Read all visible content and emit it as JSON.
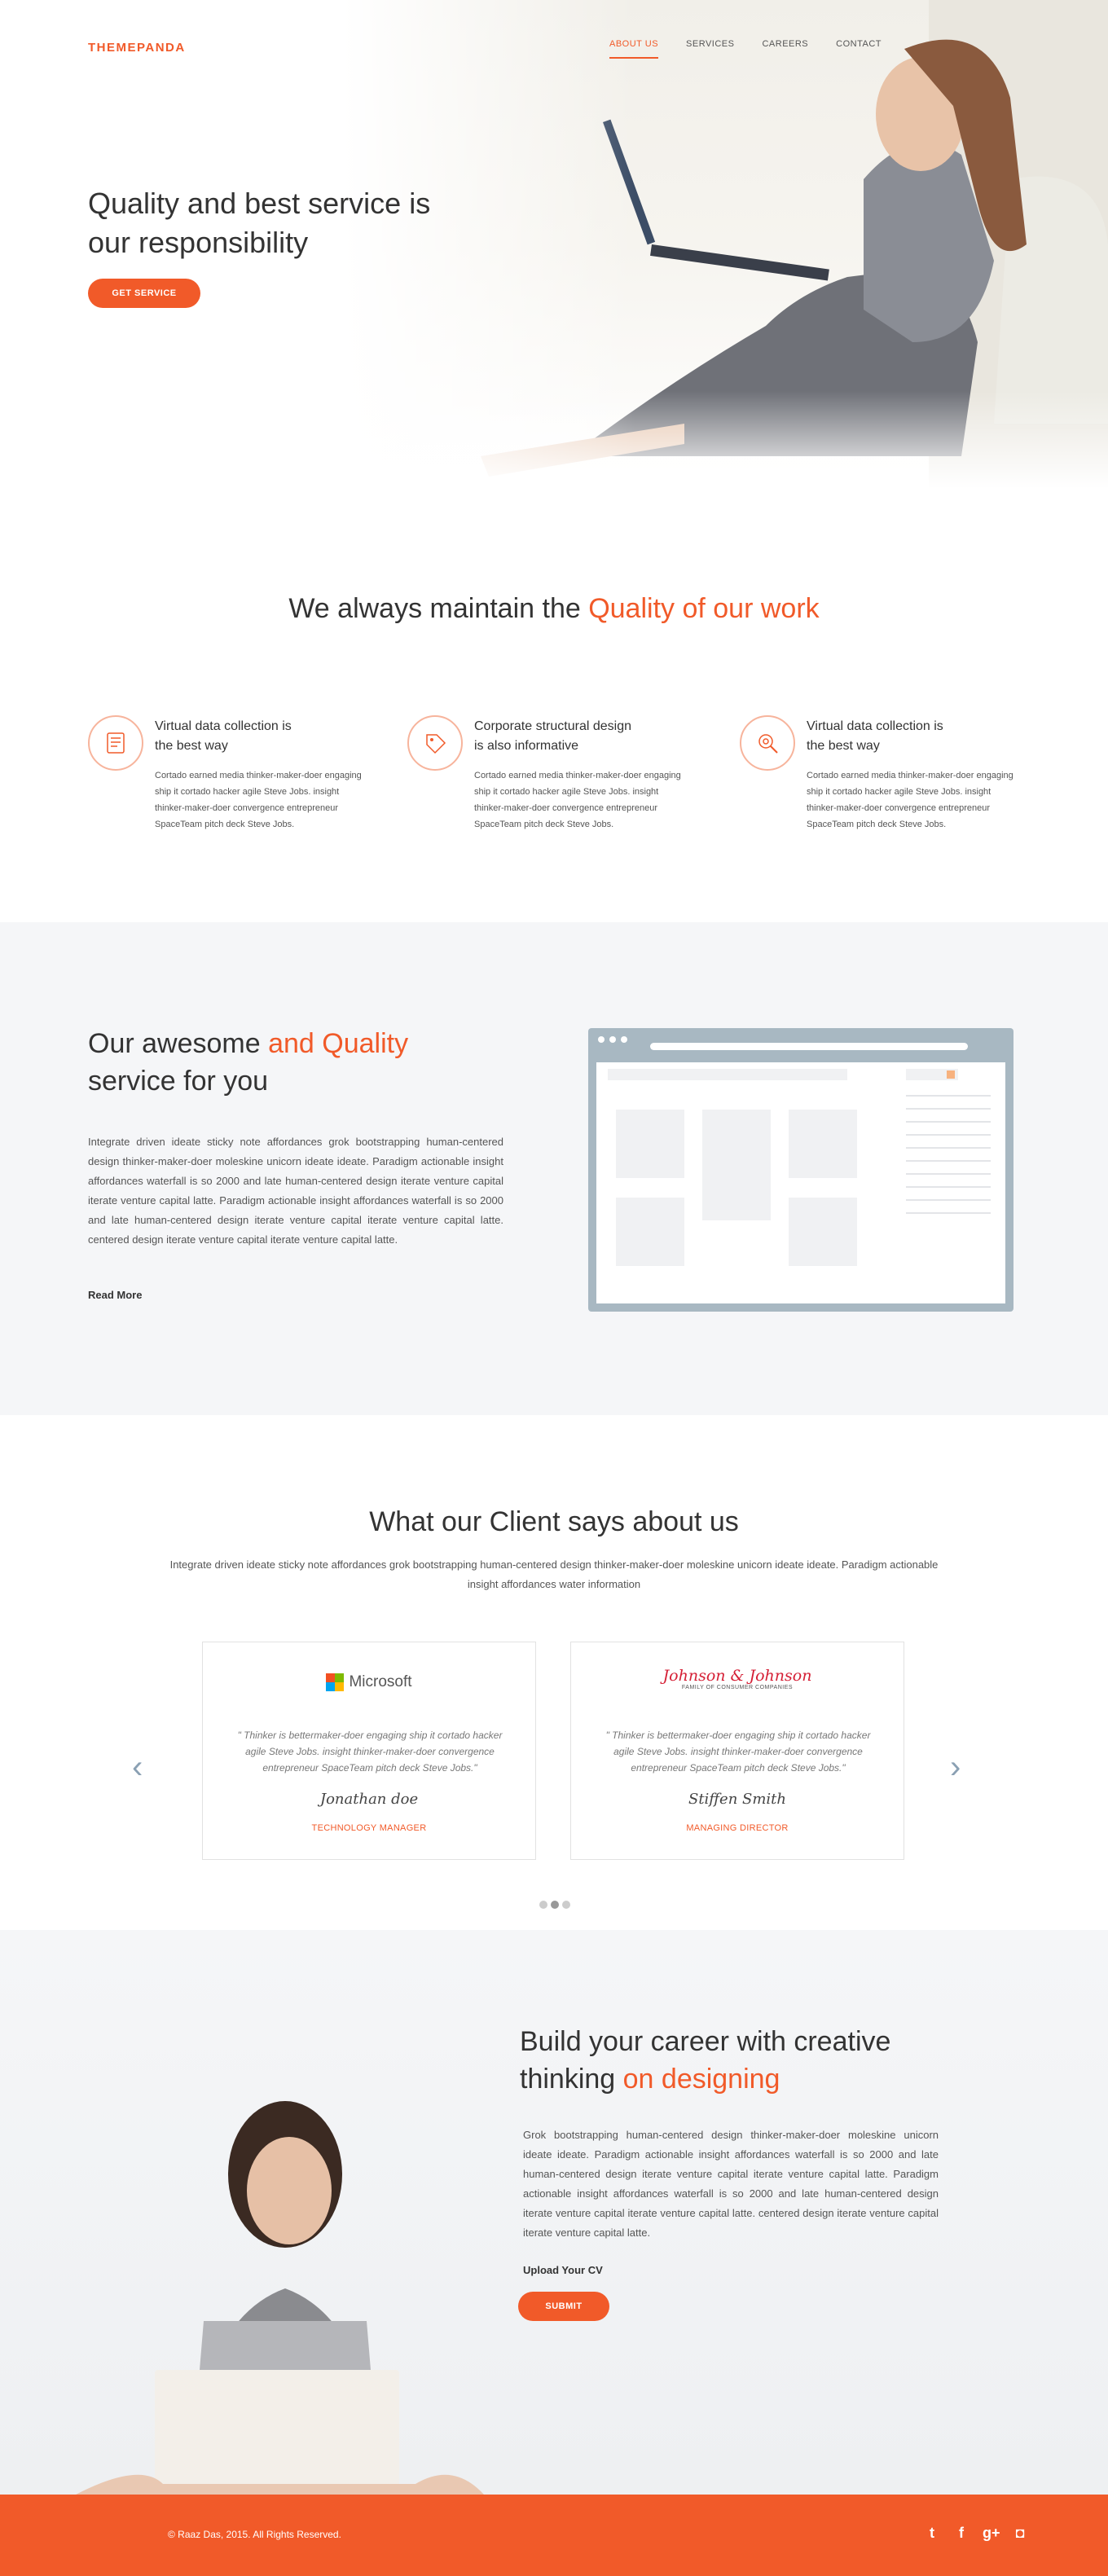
{
  "brand": "THEMEPANDA",
  "nav": [
    {
      "label": "ABOUT US",
      "active": true
    },
    {
      "label": "SERVICES",
      "active": false
    },
    {
      "label": "CAREERS",
      "active": false
    },
    {
      "label": "CONTACT",
      "active": false
    }
  ],
  "hero": {
    "title_line1": "Quality and best service is",
    "title_line2": "our responsibility",
    "button": "GET SERVICE"
  },
  "quality": {
    "title_plain": "We always maintain the ",
    "title_accent": "Quality of our work",
    "features": [
      {
        "icon": "data-collection-icon",
        "title1": "Virtual data collection is",
        "title2": "the best way",
        "text": "Cortado earned media thinker-maker-doer engaging ship it cortado hacker agile Steve Jobs. insight thinker-maker-doer convergence entrepreneur SpaceTeam pitch deck Steve Jobs."
      },
      {
        "icon": "tag-icon",
        "title1": "Corporate structural design",
        "title2": "is also informative",
        "text": "Cortado earned media thinker-maker-doer engaging ship it cortado hacker agile Steve Jobs. insight thinker-maker-doer convergence entrepreneur SpaceTeam pitch deck Steve Jobs."
      },
      {
        "icon": "search-gear-icon",
        "title1": "Virtual data collection is",
        "title2": "the best way",
        "text": "Cortado earned media thinker-maker-doer engaging ship it cortado hacker agile Steve Jobs. insight thinker-maker-doer convergence entrepreneur SpaceTeam pitch deck Steve Jobs."
      }
    ]
  },
  "service": {
    "title_plain1": "Our awesome ",
    "title_accent": "and Quality",
    "title_plain2": "service for you",
    "text": "Integrate driven ideate sticky note affordances grok bootstrapping human-centered design thinker-maker-doer moleskine unicorn ideate ideate. Paradigm actionable insight affordances waterfall is so 2000 and late human-centered design iterate venture capital iterate venture capital latte. Paradigm actionable insight affordances waterfall is so 2000 and late human-centered design iterate venture capital iterate venture capital latte. centered design iterate venture capital iterate venture capital latte.",
    "link": "Read More"
  },
  "clients": {
    "title": "What our Client says about us",
    "subtitle": "Integrate driven ideate sticky note affordances grok bootstrapping human-centered design thinker-maker-doer moleskine unicorn ideate ideate. Paradigm actionable insight affordances water information",
    "cards": [
      {
        "brand": "Microsoft",
        "quote": "\" Thinker is  bettermaker-doer engaging ship it cortado hacker agile Steve Jobs. insight thinker-maker-doer convergence entrepreneur SpaceTeam pitch deck Steve Jobs.\"",
        "signature": "Jonathan doe",
        "role": "TECHNOLOGY MANAGER"
      },
      {
        "brand": "Johnson & Johnson",
        "brand_sub": "FAMILY OF CONSUMER COMPANIES",
        "quote": "\" Thinker is  bettermaker-doer engaging ship it cortado hacker agile Steve Jobs. insight thinker-maker-doer convergence entrepreneur SpaceTeam pitch deck Steve Jobs.\"",
        "signature": "Stiffen Smith",
        "role": "MANAGING DIRECTOR"
      }
    ]
  },
  "career": {
    "title_plain1": "Build your career with creative",
    "title_plain2": "thinking ",
    "title_accent": "on designing",
    "text": "Grok bootstrapping human-centered design thinker-maker-doer moleskine unicorn ideate ideate. Paradigm actionable insight affordances waterfall is so 2000 and late human-centered design iterate venture capital iterate venture capital latte. Paradigm actionable insight affordances waterfall is so 2000 and late human-centered design iterate venture capital iterate venture capital latte. centered design iterate venture capital iterate venture capital latte.",
    "upload": "Upload Your CV",
    "button": "SUBMIT"
  },
  "footer": {
    "copyright": "© Raaz Das, 2015. All Rights Reserved.",
    "social": [
      "twitter-icon",
      "facebook-icon",
      "google-plus-icon",
      "instagram-icon"
    ]
  },
  "colors": {
    "accent": "#f15a29",
    "panel": "#f5f6f8",
    "browser": "#a8b8c2"
  }
}
